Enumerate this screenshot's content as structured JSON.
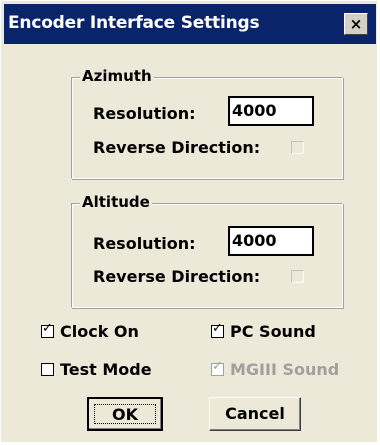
{
  "window": {
    "title": "Encoder Interface Settings",
    "close_label": "×"
  },
  "azimuth": {
    "legend": "Azimuth",
    "resolution_label": "Resolution:",
    "resolution_value": "4000",
    "reverse_label": "Reverse Direction:",
    "reverse_checked": false
  },
  "altitude": {
    "legend": "Altitude",
    "resolution_label": "Resolution:",
    "resolution_value": "4000",
    "reverse_label": "Reverse Direction:",
    "reverse_checked": false
  },
  "options": {
    "clock_on": {
      "label": "Clock On",
      "checked": true,
      "mark": "✓"
    },
    "pc_sound": {
      "label": "PC Sound",
      "checked": true,
      "mark": "✓"
    },
    "test_mode": {
      "label": "Test Mode",
      "checked": false,
      "mark": ""
    },
    "mgiii_sound": {
      "label": "MGIII Sound",
      "checked": true,
      "disabled": true,
      "mark": "✓"
    }
  },
  "buttons": {
    "ok": "OK",
    "cancel": "Cancel"
  }
}
